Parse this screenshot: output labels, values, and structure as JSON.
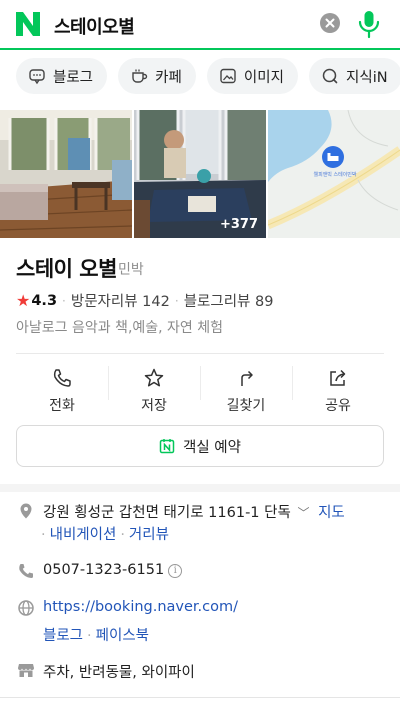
{
  "search": {
    "query": "스테이오별"
  },
  "tabs": [
    {
      "label": "블로그",
      "icon": "blog-icon"
    },
    {
      "label": "카페",
      "icon": "cafe-cup-icon"
    },
    {
      "label": "이미지",
      "icon": "image-icon"
    },
    {
      "label": "지식iN",
      "icon": "qna-icon"
    },
    {
      "label": "",
      "icon": "person-icon"
    }
  ],
  "gallery": {
    "more_count": "+377",
    "map_label": "웰피앤빅 스테이민박"
  },
  "place": {
    "name": "스테이 오별",
    "category": "민박",
    "rating": "4.3",
    "visitor_reviews": "방문자리뷰 142",
    "blog_reviews": "블로그리뷰 89",
    "tagline": "아날로그 음악과 책,예술, 자연 체험"
  },
  "actions": [
    {
      "label": "전화",
      "icon": "phone-icon"
    },
    {
      "label": "저장",
      "icon": "star-outline-icon"
    },
    {
      "label": "길찾기",
      "icon": "directions-icon"
    },
    {
      "label": "공유",
      "icon": "share-icon"
    }
  ],
  "booking": {
    "label": "객실 예약"
  },
  "info": {
    "address": "강원 횡성군 갑천면 태기로 1161-1 단독",
    "map_link": "지도",
    "navigation_link": "내비게이션",
    "street_view_link": "거리뷰",
    "phone": "0507-1323-6151",
    "website": "https://booking.naver.com/",
    "blog_link": "블로그",
    "facebook_link": "페이스북",
    "amenities": "주차, 반려동물, 와이파이"
  },
  "colors": {
    "brand_green": "#03c75a",
    "link_blue": "#2255b8",
    "star_red": "#f03c38"
  }
}
